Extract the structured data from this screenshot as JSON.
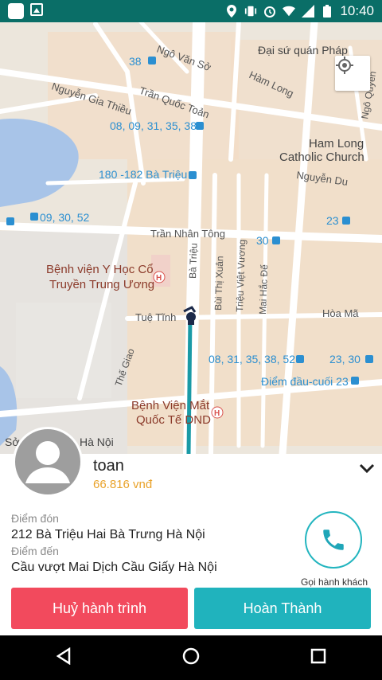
{
  "status_bar": {
    "time": "10:40"
  },
  "map": {
    "labels": {
      "l1": "Đại sứ quán Pháp",
      "l2": "Ngô Văn Sở",
      "l3": "38",
      "l4": "Hàm Long",
      "l5": "Trần Quốc Toản",
      "l6": "Nguyễn Gia Thiều",
      "l7": "08, 09, 31, 35, 38",
      "l8": "Ham Long",
      "l9": "Catholic Church",
      "l10": "180 -182 Bà Triệu",
      "l11": "Nguyễn Du",
      "l12": "09, 30, 52",
      "l13": "23",
      "l14": "Trần Nhân Tông",
      "l15": "30",
      "l16": "Bệnh viện Y Học Cổ",
      "l17": "Truyền Trung Ương",
      "l18": "Bà Triệu",
      "l19": "Bùi Thị Xuân",
      "l20": "Triệu Việt Vương",
      "l21": "Mai Hắc Đế",
      "l22": "Tuệ Tĩnh",
      "l23": "Hòa Mã",
      "l24": "Thế Giao",
      "l25": "08, 31, 35, 38, 52",
      "l26": "23, 30",
      "l27": "Điểm đầu-cuối 23",
      "l28": "Bệnh Viện Mắt",
      "l29": "Quốc Tế DND",
      "l30": "Sở",
      "l31": "Hà Nội",
      "l32": "Ngô Quyền"
    }
  },
  "trip": {
    "driver_name": "toan",
    "fare": "66.816 vnđ",
    "pickup_label": "Điểm đón",
    "pickup_address": "212 Bà Triệu Hai Bà Trưng Hà Nội",
    "dropoff_label": "Điểm đến",
    "dropoff_address": "Cầu vượt Mai Dịch Cầu Giấy Hà Nội",
    "call_label": "Gọi hành khách"
  },
  "actions": {
    "cancel_label": "Huỷ hành trình",
    "done_label": "Hoàn Thành"
  },
  "colors": {
    "status_bar": "#0a6e67",
    "accent": "#20b3bd",
    "cancel": "#f24a5d",
    "fare": "#e9a229"
  }
}
